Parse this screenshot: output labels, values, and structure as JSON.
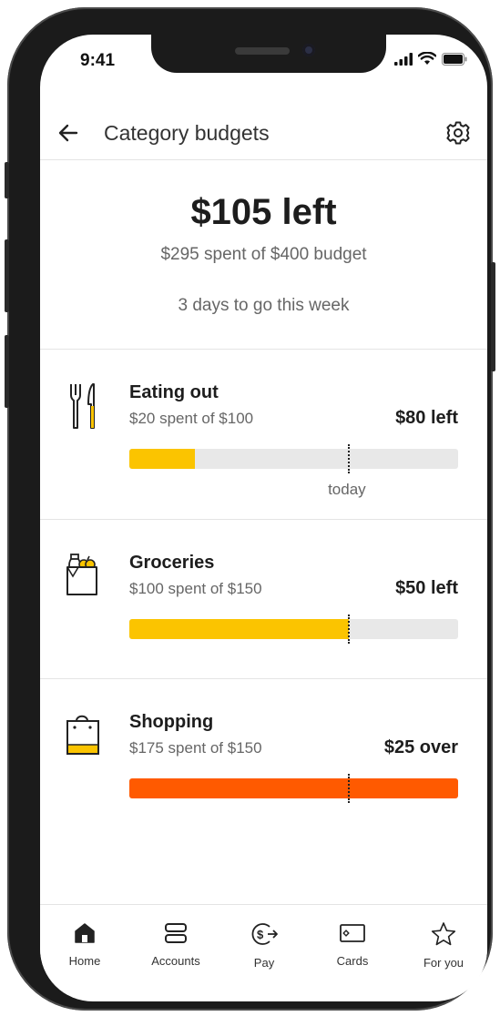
{
  "status_bar": {
    "time": "9:41"
  },
  "header": {
    "title": "Category budgets",
    "back_icon": "arrow-left-icon",
    "settings_icon": "gear-icon"
  },
  "summary": {
    "amount_left": "$105 left",
    "spent_text": "$295 spent of $400 budget",
    "days_text": "3 days to go this week"
  },
  "categories": [
    {
      "name": "Eating out",
      "spent_text": "$20 spent of $100",
      "remaining_text": "$80 left",
      "progress": 0.2,
      "icon": "fork-knife-icon",
      "bar_color": "#FBC400",
      "today_label": "today"
    },
    {
      "name": "Groceries",
      "spent_text": "$100 spent of $150",
      "remaining_text": "$50 left",
      "progress": 0.667,
      "icon": "grocery-bag-icon",
      "bar_color": "#FBC400"
    },
    {
      "name": "Shopping",
      "spent_text": "$175 spent of $150",
      "remaining_text": "$25 over",
      "progress": 1.0,
      "icon": "shopping-bag-icon",
      "bar_color": "#FF5A00"
    }
  ],
  "today_progress": 0.665,
  "bottom_nav": [
    {
      "label": "Home",
      "icon": "home-icon"
    },
    {
      "label": "Accounts",
      "icon": "accounts-icon"
    },
    {
      "label": "Pay",
      "icon": "pay-icon"
    },
    {
      "label": "Cards",
      "icon": "card-icon"
    },
    {
      "label": "For you",
      "icon": "star-icon"
    }
  ],
  "colors": {
    "accent_yellow": "#FBC400",
    "over_budget_orange": "#FF5A00",
    "track_gray": "#E8E8E8"
  }
}
